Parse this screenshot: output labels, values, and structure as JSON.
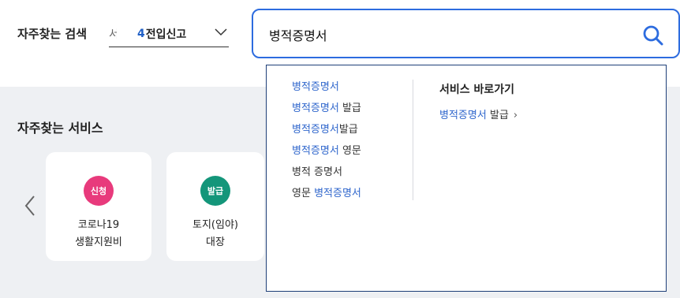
{
  "header": {
    "frequent_search_label": "자주찾는 검색",
    "keyword_rotator": {
      "prev_fragment": "서",
      "rank": "4",
      "keyword": "전입신고"
    }
  },
  "search": {
    "value": "병적증명서",
    "placeholder": ""
  },
  "services": {
    "title": "자주찾는 서비스",
    "cards": [
      {
        "badge": "신청",
        "badge_color": "#e83a7c",
        "line1": "코로나19",
        "line2": "생활지원비"
      },
      {
        "badge": "발급",
        "badge_color": "#14967a",
        "line1": "토지(임야)",
        "line2": "대장"
      }
    ]
  },
  "autocomplete": {
    "suggestions": [
      {
        "highlight": "병적증명서",
        "rest": ""
      },
      {
        "highlight": "병적증명서",
        "rest": " 발급"
      },
      {
        "highlight": "병적증명서",
        "rest": "발급"
      },
      {
        "highlight": "병적증명서",
        "rest": " 영문"
      },
      {
        "highlight": "",
        "rest": "병적 증명서"
      },
      {
        "prefix": "영문 ",
        "highlight": "병적증명서",
        "rest": ""
      }
    ],
    "shortcut_title": "서비스 바로가기",
    "shortcut": {
      "highlight": "병적증명서",
      "rest": " 발급",
      "arrow": "›"
    }
  },
  "colors": {
    "accent_blue": "#2d6cdf",
    "highlight_text": "#2f66cc",
    "badge_apply": "#e83a7c",
    "badge_issue": "#14967a"
  },
  "icons": {
    "search": "search-icon",
    "chevron": "chevron-down-icon",
    "prev": "chevron-left-icon"
  }
}
